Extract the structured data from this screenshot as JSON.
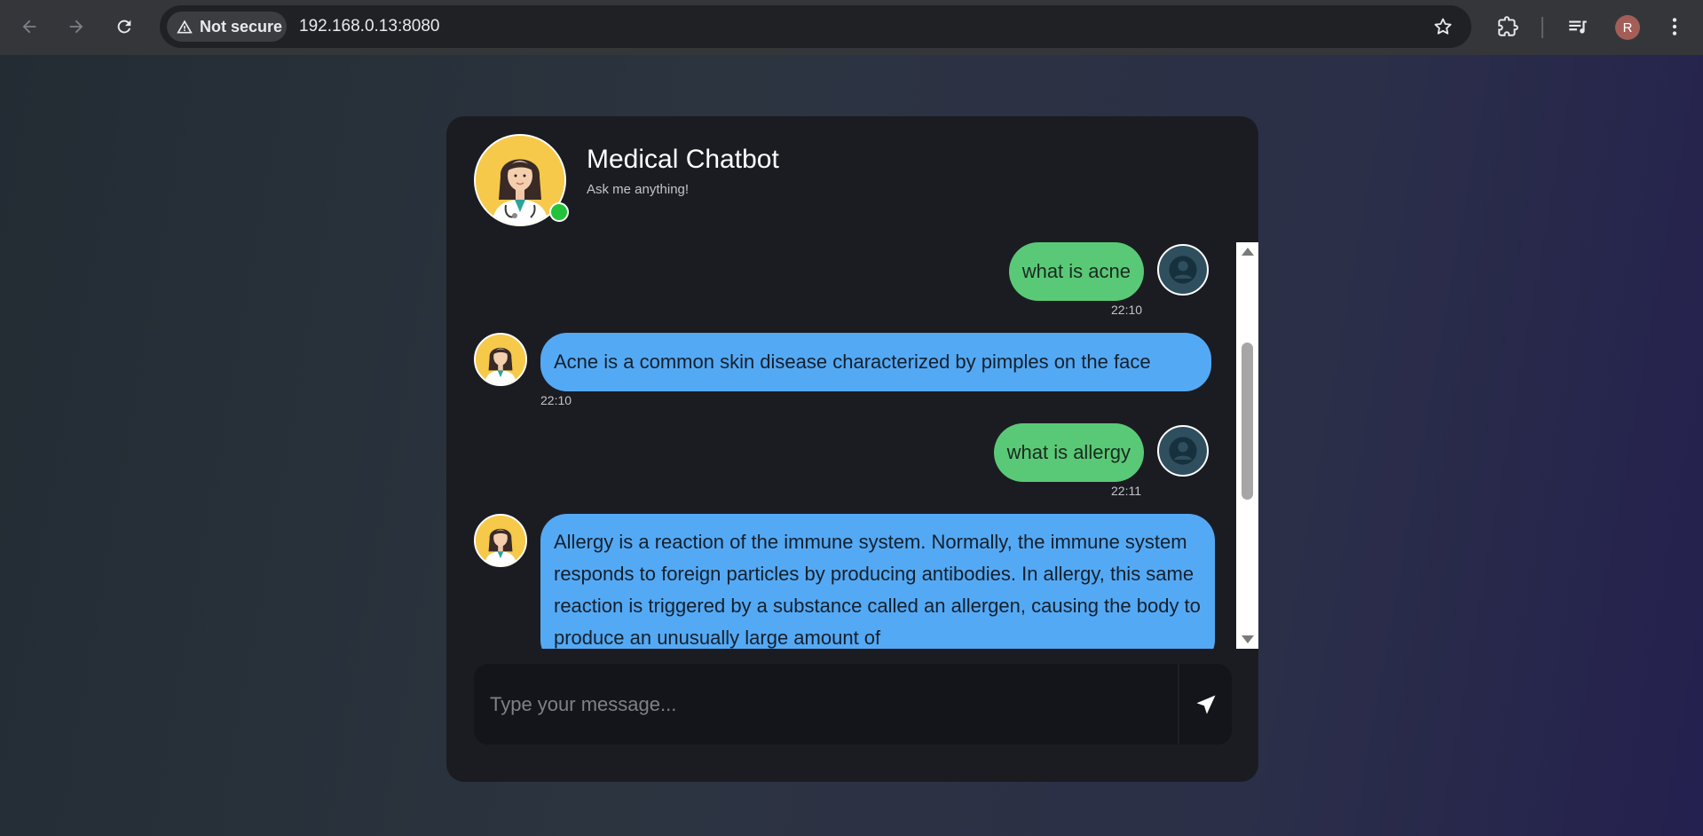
{
  "browser": {
    "security_label": "Not secure",
    "url": "192.168.0.13:8080",
    "profile_initial": "R"
  },
  "chat": {
    "title": "Medical Chatbot",
    "subtitle": "Ask me anything!",
    "messages": [
      {
        "sender": "user",
        "text": "what is acne",
        "time": "22:10"
      },
      {
        "sender": "bot",
        "text": "Acne is a common skin disease characterized by pimples on the face",
        "time": "22:10"
      },
      {
        "sender": "user",
        "text": "what is allergy",
        "time": "22:11"
      },
      {
        "sender": "bot",
        "text": "Allergy is a reaction of the immune system. Normally, the immune system responds to foreign particles by producing antibodies. In allergy, this same reaction is triggered by a substance called an allergen, causing the body to produce an unusually large amount of",
        "time": ""
      }
    ],
    "input_placeholder": "Type your message..."
  },
  "colors": {
    "user_bubble": "#5ac977",
    "bot_bubble": "#54a9f5",
    "online_indicator": "#22c23a",
    "card_background": "#1b1c22"
  },
  "icons": {
    "back": "arrow-left-icon",
    "forward": "arrow-right-icon",
    "reload": "reload-icon",
    "warning": "warning-icon",
    "bookmark": "star-icon",
    "extensions": "puzzle-icon",
    "media": "media-queue-icon",
    "menu": "kebab-menu-icon",
    "send": "send-arrow-icon",
    "user": "user-silhouette-icon",
    "bot": "doctor-avatar"
  }
}
